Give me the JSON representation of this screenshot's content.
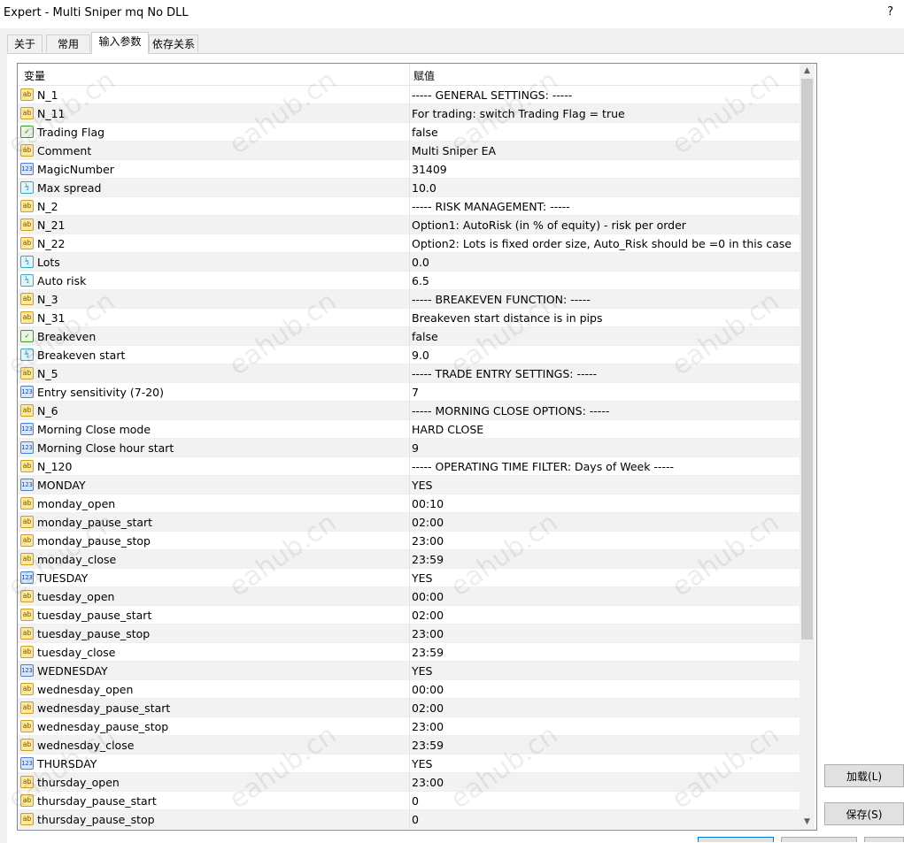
{
  "window": {
    "title": "Expert - Multi Sniper mq No DLL",
    "help": "?"
  },
  "tabs": [
    {
      "label": "关于"
    },
    {
      "label": "常用"
    },
    {
      "label": "输入参数"
    },
    {
      "label": "依存关系"
    }
  ],
  "grid": {
    "headers": {
      "name": "变量",
      "value": "赋值"
    },
    "rows": [
      {
        "icon": "ab",
        "name": "N_1",
        "value": "----- GENERAL SETTINGS: -----"
      },
      {
        "icon": "ab",
        "name": "N_11",
        "value": "For trading: switch Trading Flag = true"
      },
      {
        "icon": "bool",
        "name": "Trading Flag",
        "value": "false"
      },
      {
        "icon": "ab",
        "name": "Comment",
        "value": " Multi Sniper EA"
      },
      {
        "icon": "num",
        "name": "MagicNumber",
        "value": "31409"
      },
      {
        "icon": "dbl",
        "name": "Max spread",
        "value": "10.0"
      },
      {
        "icon": "ab",
        "name": "N_2",
        "value": "----- RISK MANAGEMENT: -----"
      },
      {
        "icon": "ab",
        "name": "N_21",
        "value": "Option1: AutoRisk (in % of equity) - risk per order"
      },
      {
        "icon": "ab",
        "name": "N_22",
        "value": "Option2: Lots is fixed order size, Auto_Risk should be =0 in this case"
      },
      {
        "icon": "dbl",
        "name": "Lots",
        "value": "0.0"
      },
      {
        "icon": "dbl",
        "name": "Auto risk",
        "value": "6.5"
      },
      {
        "icon": "ab",
        "name": "N_3",
        "value": "-----  BREAKEVEN FUNCTION: -----"
      },
      {
        "icon": "ab",
        "name": "N_31",
        "value": "Breakeven start distance is in pips"
      },
      {
        "icon": "bool",
        "name": "Breakeven",
        "value": "false"
      },
      {
        "icon": "dbl",
        "name": "Breakeven start",
        "value": "9.0"
      },
      {
        "icon": "ab",
        "name": "N_5",
        "value": "----- TRADE ENTRY SETTINGS: -----"
      },
      {
        "icon": "num",
        "name": "Entry sensitivity (7-20)",
        "value": "7"
      },
      {
        "icon": "ab",
        "name": "N_6",
        "value": "----- MORNING CLOSE OPTIONS: -----"
      },
      {
        "icon": "num",
        "name": "Morning Close mode",
        "value": "HARD CLOSE"
      },
      {
        "icon": "num",
        "name": "Morning Close hour start",
        "value": "9"
      },
      {
        "icon": "ab",
        "name": "N_120",
        "value": "----- OPERATING TIME FILTER: Days of Week -----"
      },
      {
        "icon": "num",
        "name": "MONDAY",
        "value": "YES"
      },
      {
        "icon": "ab",
        "name": "monday_open",
        "value": "00:10"
      },
      {
        "icon": "ab",
        "name": "monday_pause_start",
        "value": "02:00"
      },
      {
        "icon": "ab",
        "name": "monday_pause_stop",
        "value": "23:00"
      },
      {
        "icon": "ab",
        "name": "monday_close",
        "value": "23:59"
      },
      {
        "icon": "num",
        "name": "TUESDAY",
        "value": "YES"
      },
      {
        "icon": "ab",
        "name": "tuesday_open",
        "value": "00:00"
      },
      {
        "icon": "ab",
        "name": "tuesday_pause_start",
        "value": "02:00"
      },
      {
        "icon": "ab",
        "name": "tuesday_pause_stop",
        "value": "23:00"
      },
      {
        "icon": "ab",
        "name": "tuesday_close",
        "value": "23:59"
      },
      {
        "icon": "num",
        "name": "WEDNESDAY",
        "value": "YES"
      },
      {
        "icon": "ab",
        "name": "wednesday_open",
        "value": "00:00"
      },
      {
        "icon": "ab",
        "name": "wednesday_pause_start",
        "value": "02:00"
      },
      {
        "icon": "ab",
        "name": "wednesday_pause_stop",
        "value": "23:00"
      },
      {
        "icon": "ab",
        "name": "wednesday_close",
        "value": "23:59"
      },
      {
        "icon": "num",
        "name": "THURSDAY",
        "value": "YES"
      },
      {
        "icon": "ab",
        "name": "thursday_open",
        "value": "23:00"
      },
      {
        "icon": "ab",
        "name": "thursday_pause_start",
        "value": "0"
      },
      {
        "icon": "ab",
        "name": "thursday_pause_stop",
        "value": "0"
      }
    ]
  },
  "icons": {
    "ab": {
      "glyph": "ab",
      "semantic": "string-type-icon"
    },
    "num": {
      "glyph": "123",
      "semantic": "integer-type-icon"
    },
    "dbl": {
      "glyph": "½",
      "semantic": "double-type-icon"
    },
    "bool": {
      "glyph": "✓",
      "semantic": "boolean-type-icon"
    }
  },
  "buttons": {
    "load": "加载(L)",
    "save": "保存(S)"
  },
  "watermark": "eahub.cn"
}
